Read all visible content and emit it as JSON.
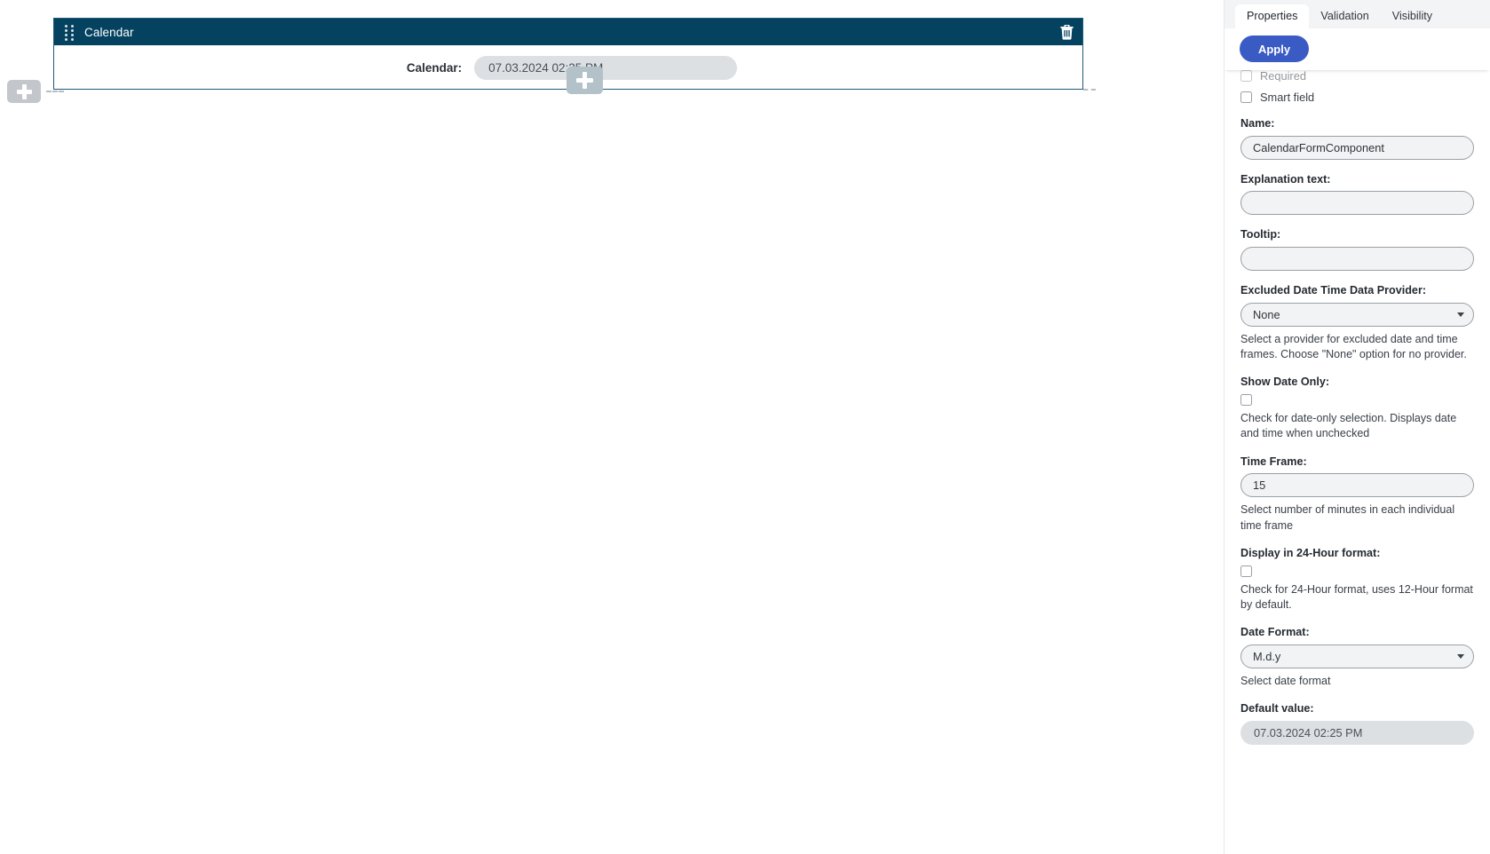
{
  "canvas": {
    "add_button_icon": "plus-icon",
    "component": {
      "title": "Calendar",
      "drag_handle_icon": "drag-handle-icon",
      "delete_icon": "trash-icon",
      "field_label": "Calendar:",
      "field_value": "07.03.2024 02:25 PM",
      "inline_add_icon": "plus-icon"
    }
  },
  "panel": {
    "tabs": [
      {
        "label": "Properties",
        "active": true
      },
      {
        "label": "Validation",
        "active": false
      },
      {
        "label": "Visibility",
        "active": false
      }
    ],
    "apply_label": "Apply",
    "required_label": "Required",
    "smart_field_label": "Smart field",
    "name": {
      "label": "Name:",
      "value": "CalendarFormComponent"
    },
    "explanation": {
      "label": "Explanation text:",
      "value": ""
    },
    "tooltip": {
      "label": "Tooltip:",
      "value": ""
    },
    "excluded_provider": {
      "label": "Excluded Date Time Data Provider:",
      "value": "None",
      "options": [
        "None"
      ],
      "hint": "Select a provider for excluded date and time frames. Choose \"None\" option for no provider."
    },
    "show_date_only": {
      "label": "Show Date Only:",
      "checked": false,
      "hint": "Check for date-only selection. Displays date and time when unchecked"
    },
    "time_frame": {
      "label": "Time Frame:",
      "value": "15",
      "hint": "Select number of minutes in each individual time frame"
    },
    "display_24h": {
      "label": "Display in 24-Hour format:",
      "checked": false,
      "hint": "Check for 24-Hour format, uses 12-Hour format by default."
    },
    "date_format": {
      "label": "Date Format:",
      "value": "M.d.y",
      "options": [
        "M.d.y"
      ],
      "hint": "Select date format"
    },
    "default_value": {
      "label": "Default value:",
      "value": "07.03.2024 02:25 PM"
    }
  },
  "colors": {
    "component_header": "#044260",
    "accent": "#3b5bc4",
    "field_bg": "#dde0e3"
  }
}
